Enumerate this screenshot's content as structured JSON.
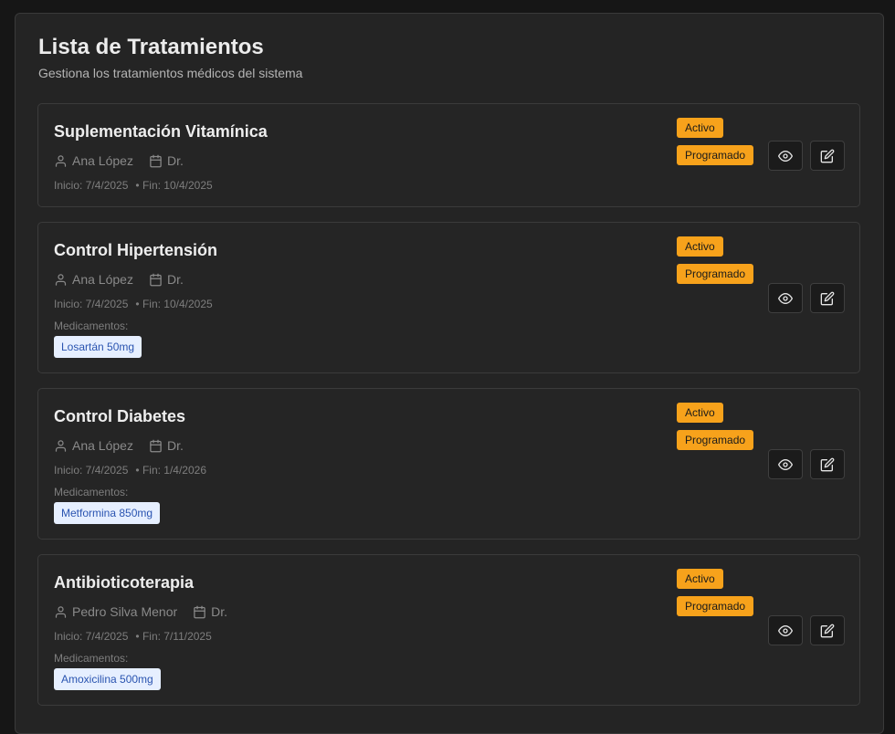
{
  "header": {
    "title": "Lista de Tratamientos",
    "subtitle": "Gestiona los tratamientos médicos del sistema"
  },
  "colors": {
    "badge": "#f7a21b",
    "chip_bg": "#e6efff",
    "chip_text": "#2a54b0",
    "card_bg": "#252525"
  },
  "icons": {
    "patient": "user-icon",
    "doctor": "calendar-icon",
    "view": "eye-icon",
    "edit": "edit-icon"
  },
  "treatments": [
    {
      "title": "Suplementación Vitamínica",
      "patient": "Ana López",
      "doctor": "Dr.",
      "start": "Inicio: 7/4/2025",
      "end": "• Fin: 10/4/2025",
      "status": "Activo",
      "schedule": "Programado",
      "medications_label": "",
      "medications": []
    },
    {
      "title": "Control Hipertensión",
      "patient": "Ana López",
      "doctor": "Dr.",
      "start": "Inicio: 7/4/2025",
      "end": "• Fin: 10/4/2025",
      "status": "Activo",
      "schedule": "Programado",
      "medications_label": "Medicamentos:",
      "medications": [
        "Losartán 50mg"
      ]
    },
    {
      "title": "Control Diabetes",
      "patient": "Ana López",
      "doctor": "Dr.",
      "start": "Inicio: 7/4/2025",
      "end": "• Fin: 1/4/2026",
      "status": "Activo",
      "schedule": "Programado",
      "medications_label": "Medicamentos:",
      "medications": [
        "Metformina 850mg"
      ]
    },
    {
      "title": "Antibioticoterapia",
      "patient": "Pedro Silva Menor",
      "doctor": "Dr.",
      "start": "Inicio: 7/4/2025",
      "end": "• Fin: 7/11/2025",
      "status": "Activo",
      "schedule": "Programado",
      "medications_label": "Medicamentos:",
      "medications": [
        "Amoxicilina 500mg"
      ]
    }
  ]
}
